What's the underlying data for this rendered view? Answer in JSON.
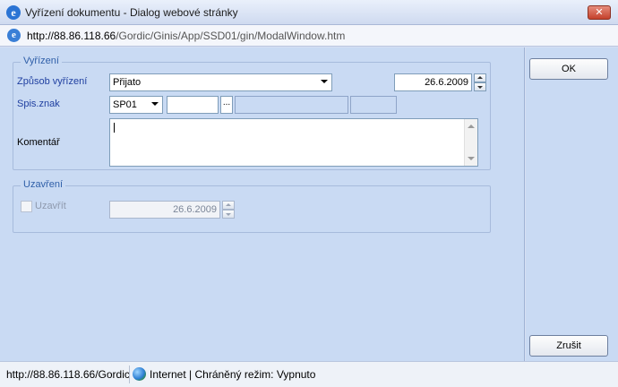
{
  "window": {
    "title": "Vyřízení dokumentu - Dialog webové stránky",
    "close_label": "✕",
    "app_icon": "ie-icon"
  },
  "address": {
    "url_host": "http://88.86.118.66",
    "url_path": "/Gordic/Ginis/App/SSD01/gin/ModalWindow.htm"
  },
  "vyrizeni": {
    "legend": "Vyřízení",
    "method_label": "Způsob vyřízení",
    "method_value": "Přijato",
    "date_value": "26.6.2009",
    "spis_label": "Spis.znak",
    "spis_value": "SP01",
    "spis_code": "",
    "browse_label": "...",
    "spis_name": "",
    "spis_extra": "",
    "comment_label": "Komentář",
    "comment_value": ""
  },
  "uzavreni": {
    "legend": "Uzavření",
    "close_label": "Uzavřít",
    "close_checked": false,
    "date_value": "26.6.2009"
  },
  "actions": {
    "ok_label": "OK",
    "cancel_label": "Zrušit"
  },
  "status": {
    "url": "http://88.86.118.66/Gordic",
    "zone": "Internet | Chráněný režim: Vypnuto"
  }
}
